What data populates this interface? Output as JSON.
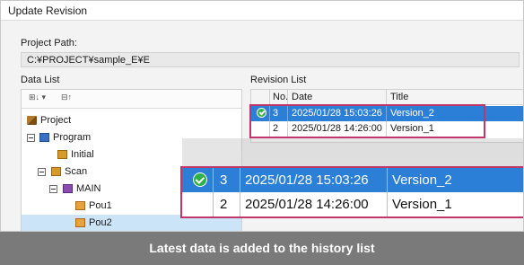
{
  "window": {
    "title": "Update Revision"
  },
  "project_path": {
    "label": "Project Path:",
    "value": "C:¥PROJECT¥sample_E¥E"
  },
  "data_list": {
    "label": "Data List",
    "toolbar": {
      "btn1": "⊞↓ ▾",
      "btn2": "⊟↑"
    },
    "tree": [
      {
        "label": "Project",
        "icon": "project-icon"
      },
      {
        "label": "Program",
        "icon": "program-icon"
      },
      {
        "label": "Initial",
        "icon": "initial-icon"
      },
      {
        "label": "Scan",
        "icon": "scan-icon"
      },
      {
        "label": "MAIN",
        "icon": "main-icon"
      },
      {
        "label": "Pou1",
        "icon": "pou-icon"
      },
      {
        "label": "Pou2",
        "icon": "pou-icon"
      }
    ]
  },
  "revision_list": {
    "label": "Revision List",
    "headers": {
      "no": "No.",
      "date": "Date",
      "title": "Title"
    },
    "rows": [
      {
        "no": "3",
        "date": "2025/01/28 15:03:26",
        "title": "Version_2",
        "latest": true
      },
      {
        "no": "2",
        "date": "2025/01/28 14:26:00",
        "title": "Version_1",
        "latest": false
      }
    ]
  },
  "colors": {
    "selection": "#2b7fd6",
    "highlight": "#c0356a",
    "check": "#2fb04a",
    "caption_bg": "#7a7a7a"
  },
  "caption": "Latest data is added to the history list"
}
